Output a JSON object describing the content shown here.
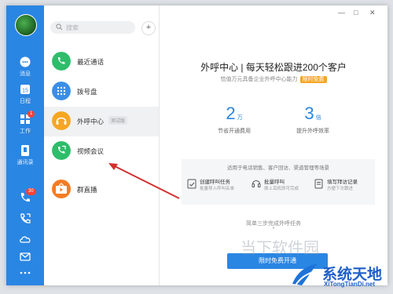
{
  "search": {
    "placeholder": "搜索"
  },
  "rail": {
    "items": [
      {
        "label": "消息"
      },
      {
        "label": "日程",
        "icon_text": "15"
      },
      {
        "label": "工作",
        "badge": "1"
      },
      {
        "label": "通讯录"
      }
    ],
    "call_badge": "30"
  },
  "nav": {
    "items": [
      {
        "label": "最近通话",
        "color": "#2ebd6b"
      },
      {
        "label": "拨号盘",
        "color": "#3a8ee6"
      },
      {
        "label": "外呼中心",
        "color": "#f5a623",
        "tag": "测试版"
      },
      {
        "label": "视频会议",
        "color": "#2ebd6b"
      },
      {
        "label": "群直播",
        "color": "#f57c23"
      }
    ]
  },
  "main": {
    "headline": "外呼中心 | 每天轻松跟进200个客户",
    "subline": "恰值万元具备企业外呼中心能力",
    "free_tag": "限时免费",
    "stats": [
      {
        "num": "2",
        "unit": "万",
        "desc": "节省开通费用"
      },
      {
        "num": "3",
        "unit": "倍",
        "desc": "提升外呼效率"
      }
    ],
    "panel_title": "适用于电话销售、客户回访、渠道管理等场景",
    "steps": [
      {
        "n": "1",
        "title": "创建呼叫任务",
        "desc": "批量导入呼叫名单"
      },
      {
        "n": "2",
        "title": "批量呼叫",
        "desc": "拨上耳机即可完成"
      },
      {
        "n": "3",
        "title": "填写拜访记录",
        "desc": "方便下次跟进"
      }
    ],
    "three_steps": "简单三步完成外呼任务",
    "dot": "•",
    "cta": "限时免费开通"
  },
  "titlebar": {
    "min": "—",
    "max": "□",
    "close": "✕"
  },
  "watermark": {
    "text": "系统天地",
    "url": "XiTongTianDi.net",
    "bg_text": "当下软件园"
  },
  "colors": {
    "accent": "#2a86e3",
    "arrow": "#d32f2f"
  }
}
